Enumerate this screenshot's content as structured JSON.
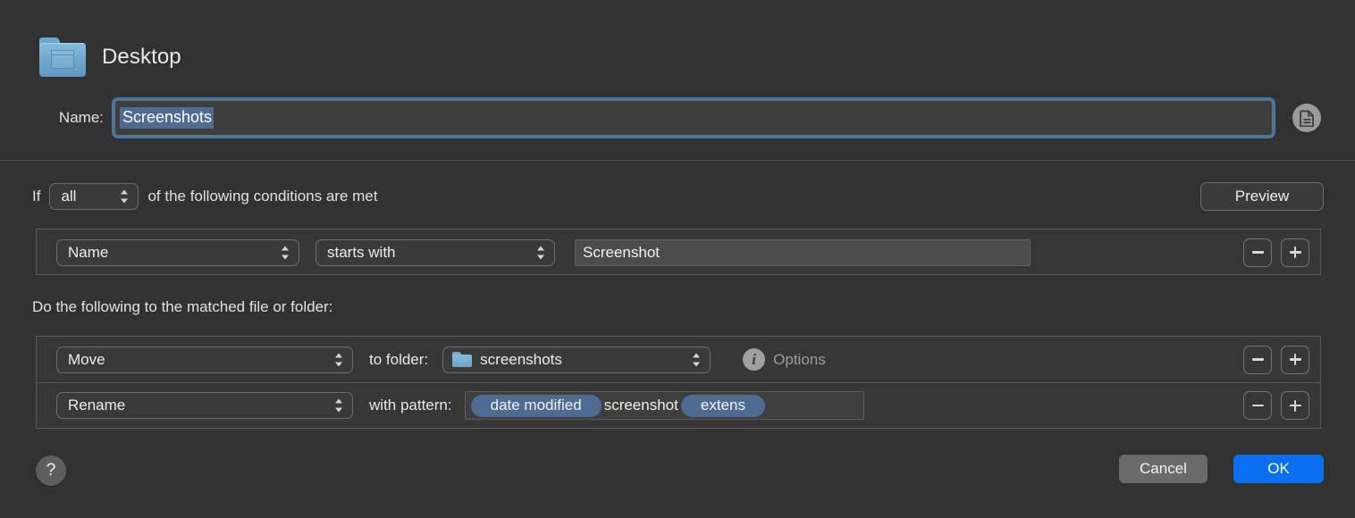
{
  "header": {
    "folder_icon": "folder-desktop-icon",
    "title": "Desktop",
    "name_label": "Name:",
    "name_value": "Screenshots",
    "doc_button_icon": "document-icon"
  },
  "conditions": {
    "if_label": "If",
    "match_mode": "all",
    "tail_label": "of the following conditions are met",
    "preview_label": "Preview",
    "rows": [
      {
        "attribute": "Name",
        "operator": "starts with",
        "value": "Screenshot",
        "remove_label": "remove-condition",
        "add_label": "add-condition"
      }
    ]
  },
  "actions": {
    "heading": "Do the following to the matched file or folder:",
    "rows": [
      {
        "action": "Move",
        "inline_label": "to folder:",
        "folder_icon": "folder-icon",
        "folder": "screenshots",
        "options_icon": "info-icon",
        "options_label": "Options"
      },
      {
        "action": "Rename",
        "inline_label": "with pattern:",
        "pattern_tokens": [
          {
            "type": "token",
            "text": "date modified"
          },
          {
            "type": "text",
            "text": "screenshot"
          },
          {
            "type": "token",
            "text": "extens"
          }
        ]
      }
    ]
  },
  "footer": {
    "help_label": "?",
    "cancel_label": "Cancel",
    "ok_label": "OK"
  },
  "colors": {
    "background": "#323232",
    "accent_blue": "#0b6ff2",
    "focus_ring": "#4a7cb0",
    "token_blue": "#4e6c91",
    "folder_blue": "#6fa6cd"
  }
}
